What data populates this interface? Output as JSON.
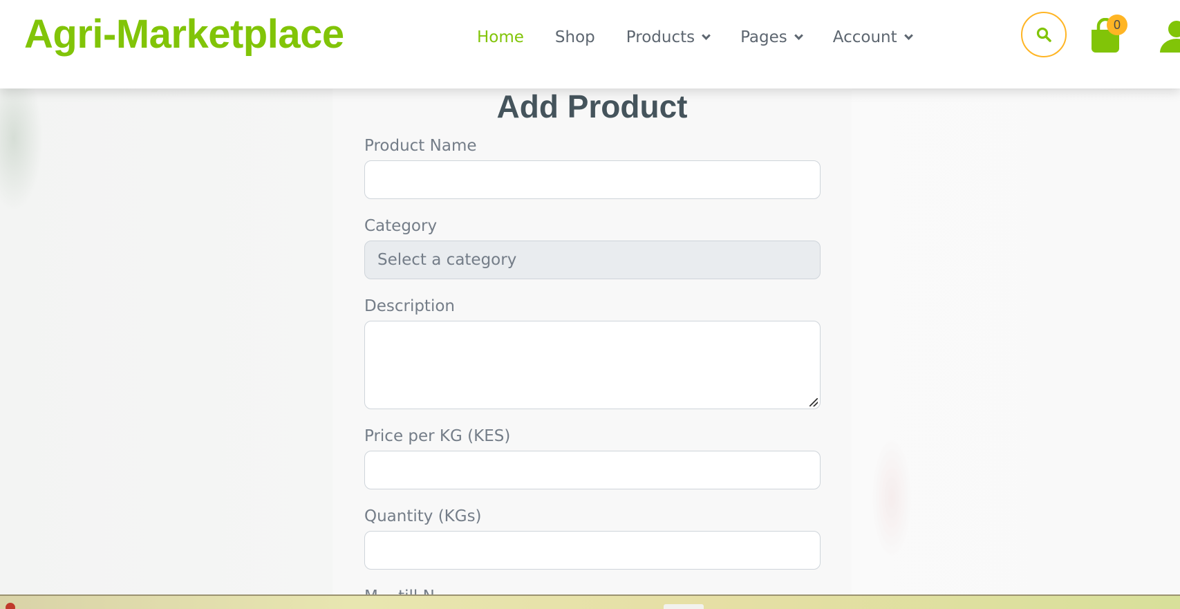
{
  "brand": {
    "name": "Agri-Marketplace",
    "color": "#81c408"
  },
  "nav": {
    "items": [
      {
        "label": "Home",
        "active": true,
        "dropdown": false
      },
      {
        "label": "Shop",
        "active": false,
        "dropdown": false
      },
      {
        "label": "Products",
        "active": false,
        "dropdown": true
      },
      {
        "label": "Pages",
        "active": false,
        "dropdown": true
      },
      {
        "label": "Account",
        "active": false,
        "dropdown": true
      }
    ],
    "search_icon": "search-icon",
    "cart_icon": "shopping-bag-icon",
    "cart_count": "0",
    "user_icon": "user-icon",
    "accent": "#ffb524"
  },
  "form": {
    "title": "Add Product",
    "product_name": {
      "label": "Product Name",
      "value": ""
    },
    "category": {
      "label": "Category",
      "selected": "Select a category"
    },
    "description": {
      "label": "Description",
      "value": ""
    },
    "price": {
      "label": "Price per KG (KES)",
      "value": ""
    },
    "quantity": {
      "label": "Quantity (KGs)",
      "value": ""
    },
    "next_label_partial": "M... till N..."
  }
}
